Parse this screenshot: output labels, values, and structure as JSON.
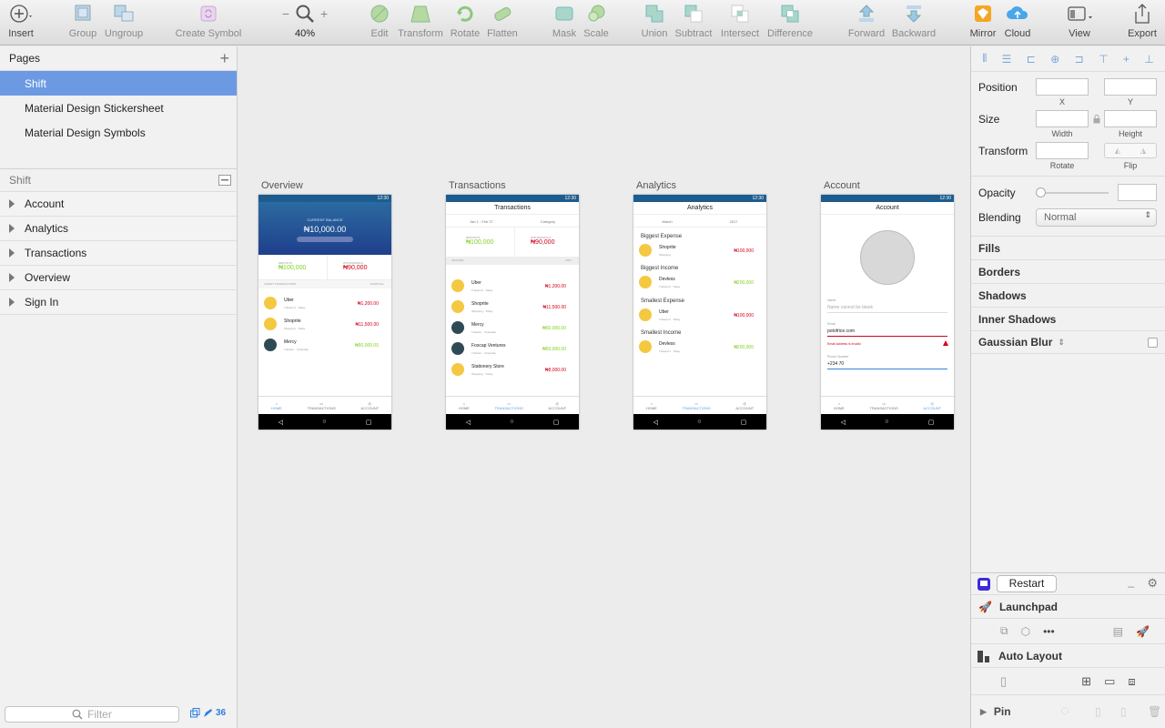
{
  "toolbar": {
    "insert": "Insert",
    "group": "Group",
    "ungroup": "Ungroup",
    "create_symbol": "Create Symbol",
    "zoom": "40%",
    "edit": "Edit",
    "transform": "Transform",
    "rotate": "Rotate",
    "flatten": "Flatten",
    "mask": "Mask",
    "scale": "Scale",
    "union": "Union",
    "subtract": "Subtract",
    "intersect": "Intersect",
    "difference": "Difference",
    "forward": "Forward",
    "backward": "Backward",
    "mirror": "Mirror",
    "cloud": "Cloud",
    "view": "View",
    "export": "Export"
  },
  "sidebar": {
    "pages_title": "Pages",
    "pages": [
      "Shift",
      "Material Design Stickersheet",
      "Material Design Symbols"
    ],
    "layers_title": "Shift",
    "layers": [
      "Account",
      "Analytics",
      "Transactions",
      "Overview",
      "Sign In"
    ],
    "filter_placeholder": "Filter",
    "count": "36"
  },
  "artboards": {
    "overview": {
      "title": "Overview",
      "time": "12:30",
      "balance_label": "CURRENT BALANCE",
      "balance": "₦10,000.00",
      "deposits_label": "DEPOSITS",
      "deposits": "₦100,000",
      "withdrawals_label": "WITHDRAWALS",
      "withdrawals": "₦90,000",
      "latest": "LATEST TRANSACTIONS",
      "show_all": "SHOW ALL",
      "rows": [
        {
          "name": "Uber",
          "sub": "Transport · Today",
          "amt": "₦1,200.00"
        },
        {
          "name": "Shoprite",
          "sub": "Shopping · Today",
          "amt": "₦11,500.00"
        },
        {
          "name": "Mercy",
          "sub": "Transfer · Yesterday",
          "amt": "₦50,000.00"
        }
      ]
    },
    "transactions": {
      "title": "Transactions",
      "header": "Transactions",
      "time": "12:30",
      "range": "Jan 1 - Feb 27",
      "category": "Category",
      "deposits_label": "DEPOSITS",
      "deposits": "₦100,000",
      "withdrawals_label": "WITHDRAWALS",
      "withdrawals": "₦90,000",
      "month": "JANUARY",
      "year": "2017",
      "rows": [
        {
          "name": "Uber",
          "sub": "Transport · Today",
          "amt": "₦1,200.00"
        },
        {
          "name": "Shoprite",
          "sub": "Shopping · Today",
          "amt": "₦11,500.00"
        },
        {
          "name": "Mercy",
          "sub": "Transfer · Yesterday",
          "amt": "₦50,000.00"
        },
        {
          "name": "Foscap Ventures",
          "sub": "Transfer · Yesterday",
          "amt": "₦50,000.00"
        },
        {
          "name": "Stationery Store",
          "sub": "Shopping · Today",
          "amt": "₦8,000.00"
        }
      ]
    },
    "analytics": {
      "title": "Analytics",
      "header": "Analytics",
      "time": "12:30",
      "month": "March",
      "year": "2017",
      "groups": [
        {
          "label": "Biggest Expense",
          "name": "Shoprite",
          "sub": "Shopping",
          "amt": "₦100,000"
        },
        {
          "label": "Biggest Income",
          "name": "Devless",
          "sub": "Transport · Today",
          "amt": "₦200,000"
        },
        {
          "label": "Smallest Expense",
          "name": "Uber",
          "sub": "Transport · Today",
          "amt": "₦100,000"
        },
        {
          "label": "Smallest Income",
          "name": "Devless",
          "sub": "Transport · Today",
          "amt": "₦200,000"
        }
      ]
    },
    "account": {
      "title": "Account",
      "header": "Account",
      "time": "12:30",
      "name_label": "Name",
      "name_placeholder": "Name cannot be blank",
      "email_label": "Email",
      "email_value": "potofrice.com",
      "email_error": "Email address is invalid",
      "phone_label": "Phone Number",
      "phone_value": "+234 70"
    },
    "tabs": {
      "home": "HOME",
      "transactions": "TRANSACTIONS",
      "account": "ACCOUNT"
    }
  },
  "inspector": {
    "position": "Position",
    "x": "X",
    "y": "Y",
    "size": "Size",
    "width": "Width",
    "height": "Height",
    "transform": "Transform",
    "rotate": "Rotate",
    "flip": "Flip",
    "opacity": "Opacity",
    "blending": "Blending",
    "blending_value": "Normal",
    "fills": "Fills",
    "borders": "Borders",
    "shadows": "Shadows",
    "inner_shadows": "Inner Shadows",
    "gaussian_blur": "Gaussian Blur"
  },
  "plugins": {
    "restart": "Restart",
    "launchpad": "Launchpad",
    "auto_layout": "Auto Layout",
    "pin": "Pin"
  }
}
